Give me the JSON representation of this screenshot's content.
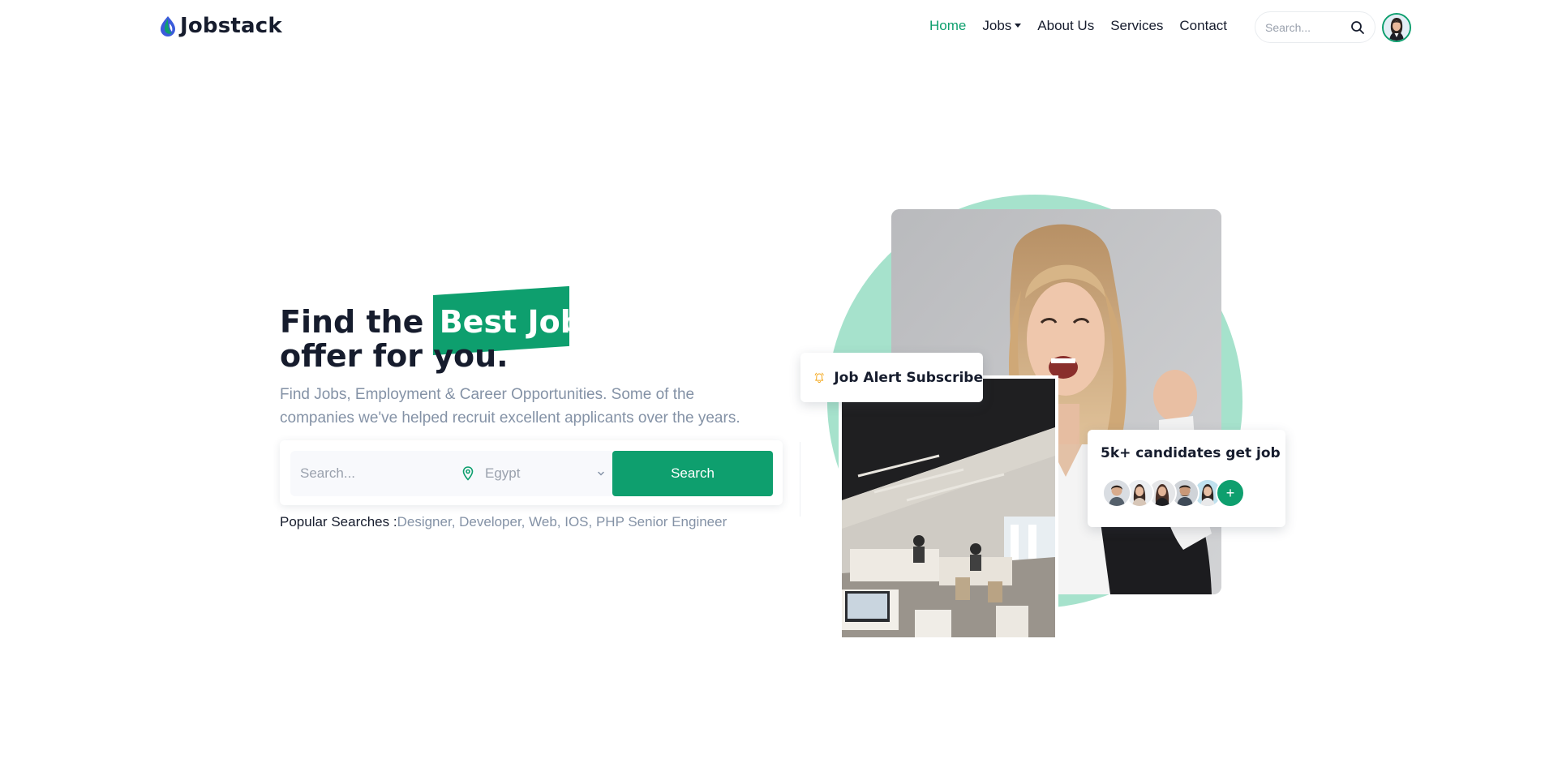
{
  "navbar": {
    "brand": "Jobstack",
    "links": [
      {
        "label": "Home",
        "active": true
      },
      {
        "label": "Jobs",
        "dropdown": true
      },
      {
        "label": "About Us"
      },
      {
        "label": "Services"
      },
      {
        "label": "Contact"
      }
    ],
    "search_placeholder": "Search...",
    "search_icon": "search-icon",
    "avatar_icon": "user-avatar"
  },
  "hero": {
    "title_prefix": "Find the",
    "title_highlight": "Best Job",
    "title_line2": "offer for you.",
    "description": "Find Jobs, Employment & Career Opportunities. Some of the companies we've helped recruit excellent applicants over the years.",
    "search": {
      "keyword_placeholder": "Search...",
      "location_value": "Egypt",
      "location_icon": "map-pin-icon",
      "button_label": "Search"
    },
    "popular_label": "Popular Searches :",
    "popular_tags": "Designer, Developer, Web, IOS, PHP Senior Engineer"
  },
  "cards": {
    "alert_label": "Job Alert Subscribe",
    "alert_icon": "bell-icon",
    "candidates_label": "5k+ candidates get job",
    "candidate_count_avatars": 5,
    "plus_label": "+"
  },
  "colors": {
    "accent": "#0e9f6e",
    "circle": "#88d8bb",
    "text_dark": "#161c2d",
    "text_muted": "#8492a6"
  }
}
